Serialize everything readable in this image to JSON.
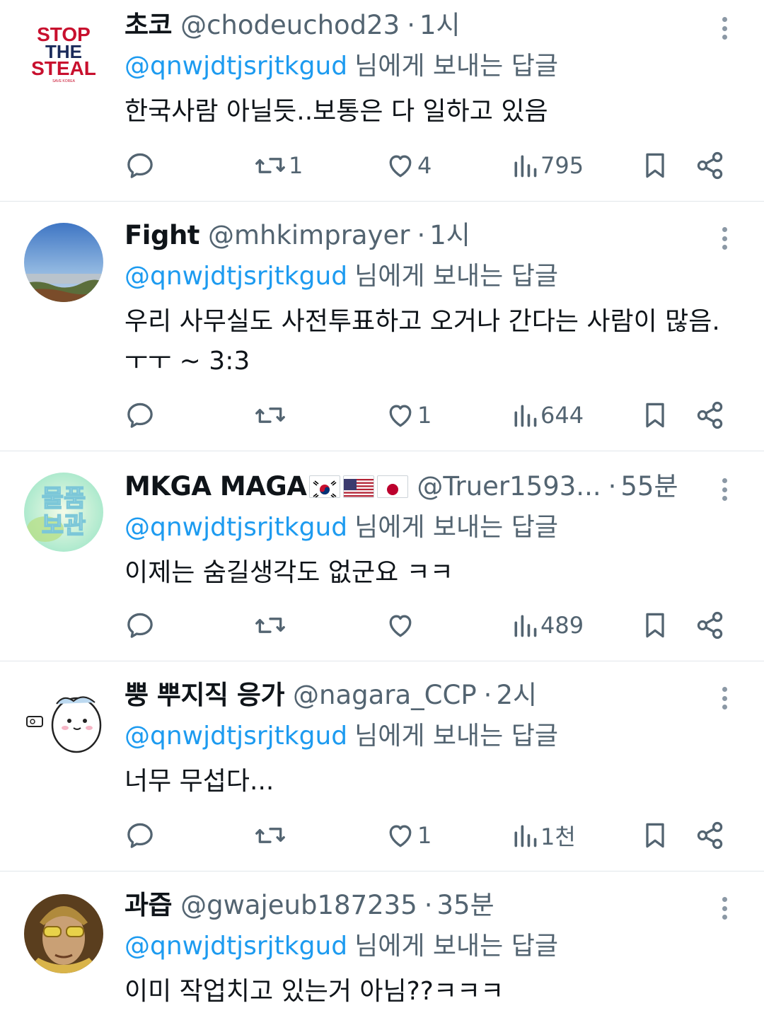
{
  "reply_prefix": "@qnwjdtjsrjtkgud",
  "reply_suffix": "님에게 보내는 답글",
  "tweets": [
    {
      "name": "초코",
      "handle": "@chodeuchod23",
      "time": "1시",
      "text": "한국사람 아닐듯..보통은 다 일하고 있음",
      "avatar": {
        "line1": "STOP",
        "line2": "THE",
        "line3": "STEAL",
        "caption": "SAVE KOREA"
      },
      "stats": {
        "replies": "",
        "retweets": "1",
        "likes": "4",
        "views": "795"
      }
    },
    {
      "name": "Fight",
      "handle": "@mhkimprayer",
      "time": "1시",
      "text": "우리 사무실도 사전투표하고 오거나 간다는 사람이 많음.ㅜㅜ ~ 3:3",
      "stats": {
        "replies": "",
        "retweets": "",
        "likes": "1",
        "views": "644"
      }
    },
    {
      "name": "MKGA MAGA",
      "flags": [
        "south-korea-flag",
        "united-states-flag",
        "japan-flag"
      ],
      "handle": "@Truer1593...",
      "time": "55분",
      "text": "이제는 숨길생각도 없군요 ㅋㅋ",
      "avatar": {
        "line1": "물품",
        "line2": "보관"
      },
      "stats": {
        "replies": "",
        "retweets": "",
        "likes": "",
        "views": "489"
      }
    },
    {
      "name": "뿡 뿌지직 응가",
      "handle": "@nagara_CCP",
      "time": "2시",
      "text": "너무 무섭다...",
      "stats": {
        "replies": "",
        "retweets": "",
        "likes": "1",
        "views": "1천"
      }
    },
    {
      "name": "과즙",
      "handle": "@gwajeub187235",
      "time": "35분",
      "text": "이미 작업치고 있는거 아님??ㅋㅋㅋ"
    }
  ],
  "icons": [
    "reply-icon",
    "retweet-icon",
    "like-icon",
    "views-icon",
    "bookmark-icon",
    "share-icon",
    "more-icon"
  ],
  "colors": {
    "link": "#1d9bf0",
    "secondary": "#536471",
    "text": "#0f1419",
    "divider": "#e1e6ea"
  }
}
